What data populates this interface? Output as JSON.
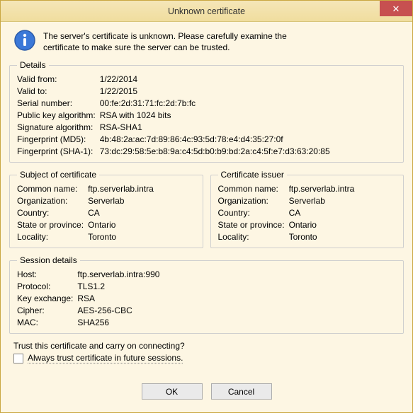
{
  "window": {
    "title": "Unknown certificate",
    "close_glyph": "✕"
  },
  "message": {
    "line1": "The server's certificate is unknown. Please carefully examine the",
    "line2": "certificate to make sure the server can be trusted."
  },
  "details": {
    "legend": "Details",
    "valid_from_k": "Valid from:",
    "valid_from_v": "1/22/2014",
    "valid_to_k": "Valid to:",
    "valid_to_v": "1/22/2015",
    "serial_k": "Serial number:",
    "serial_v": "00:fe:2d:31:71:fc:2d:7b:fc",
    "pubkey_k": "Public key algorithm:",
    "pubkey_v": "RSA with 1024 bits",
    "sig_k": "Signature algorithm:",
    "sig_v": "RSA-SHA1",
    "fp_md5_k": "Fingerprint (MD5):",
    "fp_md5_v": "4b:48:2a:ac:7d:89:86:4c:93:5d:78:e4:d4:35:27:0f",
    "fp_sha1_k": "Fingerprint (SHA-1):",
    "fp_sha1_v": "73:dc:29:58:5e:b8:9a:c4:5d:b0:b9:bd:2a:c4:5f:e7:d3:63:20:85"
  },
  "subject": {
    "legend": "Subject of certificate",
    "cn_k": "Common name:",
    "cn_v": "ftp.serverlab.intra",
    "org_k": "Organization:",
    "org_v": "Serverlab",
    "country_k": "Country:",
    "country_v": "CA",
    "state_k": "State or province:",
    "state_v": "Ontario",
    "locality_k": "Locality:",
    "locality_v": "Toronto"
  },
  "issuer": {
    "legend": "Certificate issuer",
    "cn_k": "Common name:",
    "cn_v": "ftp.serverlab.intra",
    "org_k": "Organization:",
    "org_v": "Serverlab",
    "country_k": "Country:",
    "country_v": "CA",
    "state_k": "State or province:",
    "state_v": "Ontario",
    "locality_k": "Locality:",
    "locality_v": "Toronto"
  },
  "session": {
    "legend": "Session details",
    "host_k": "Host:",
    "host_v": "ftp.serverlab.intra:990",
    "proto_k": "Protocol:",
    "proto_v": "TLS1.2",
    "kex_k": "Key exchange:",
    "kex_v": "RSA",
    "cipher_k": "Cipher:",
    "cipher_v": "AES-256-CBC",
    "mac_k": "MAC:",
    "mac_v": "SHA256"
  },
  "trust": {
    "question": "Trust this certificate and carry on connecting?",
    "checkbox_label": "Always trust certificate in future sessions."
  },
  "buttons": {
    "ok": "OK",
    "cancel": "Cancel"
  }
}
